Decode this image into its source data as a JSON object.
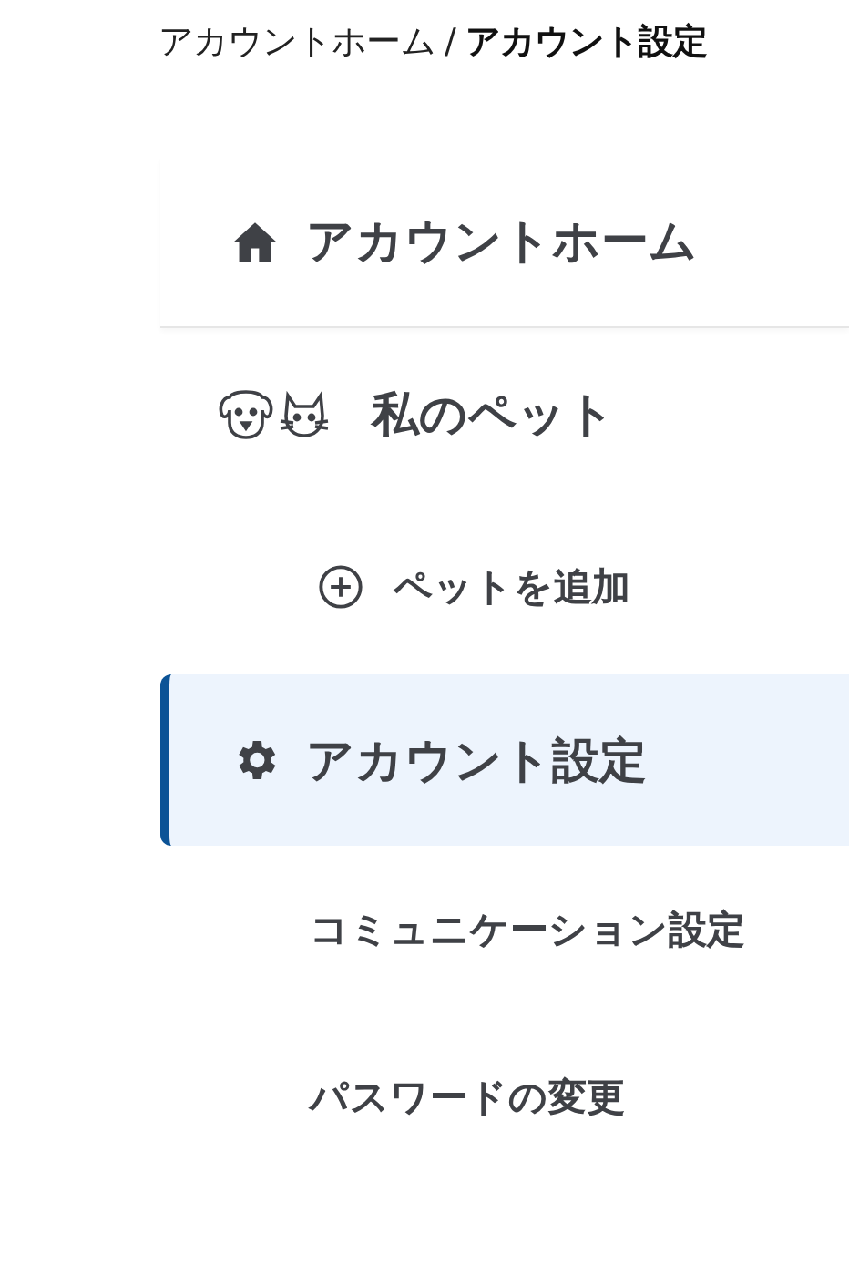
{
  "breadcrumb": {
    "link": "アカウントホーム",
    "separator": "/",
    "current": "アカウント設定"
  },
  "nav": [
    {
      "kind": "home",
      "label": "アカウントホーム",
      "selected": false
    },
    {
      "kind": "pets",
      "label": "私のペット",
      "selected": false
    },
    {
      "kind": "add",
      "label": "ペットを追加",
      "selected": false
    },
    {
      "kind": "settings",
      "label": "アカウント設定",
      "selected": true
    },
    {
      "kind": "sub",
      "label": "コミュニケーション設定",
      "selected": false
    },
    {
      "kind": "sub",
      "label": "パスワードの変更",
      "selected": false
    }
  ]
}
